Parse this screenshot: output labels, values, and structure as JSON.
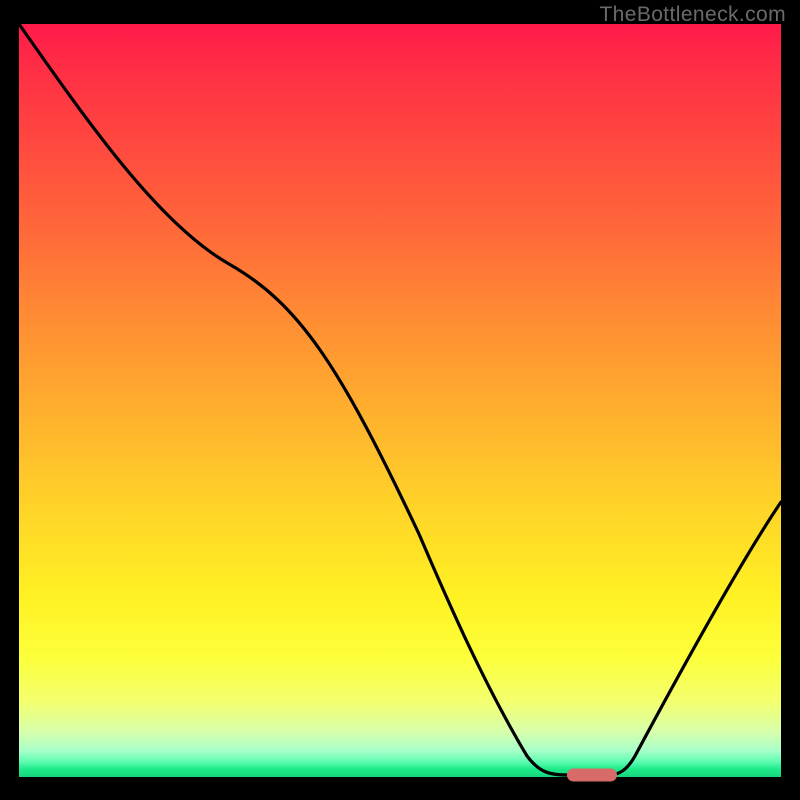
{
  "watermark": "TheBottleneck.com",
  "chart_data": {
    "type": "line",
    "title": "",
    "xlabel": "",
    "ylabel": "",
    "xlim": [
      0,
      100
    ],
    "ylim": [
      0,
      100
    ],
    "background_gradient": {
      "top": "#ff1a4a",
      "middle": "#fff123",
      "bottom": "#17d47d",
      "meaning": "red = high bottleneck, green = low bottleneck"
    },
    "series": [
      {
        "name": "bottleneck-curve",
        "x": [
          0,
          10,
          20,
          28,
          38,
          48,
          58,
          66,
          72,
          78,
          82,
          88,
          94,
          100
        ],
        "y": [
          100,
          87,
          74,
          68,
          56,
          42,
          27,
          12,
          3,
          0,
          3,
          14,
          27,
          37
        ],
        "note": "y = bottleneck severity percent (0 = optimal / green, 100 = worst / red)"
      }
    ],
    "marker": {
      "name": "optimal-range",
      "x_range": [
        72,
        78
      ],
      "y": 0,
      "color": "#d86b69"
    }
  }
}
